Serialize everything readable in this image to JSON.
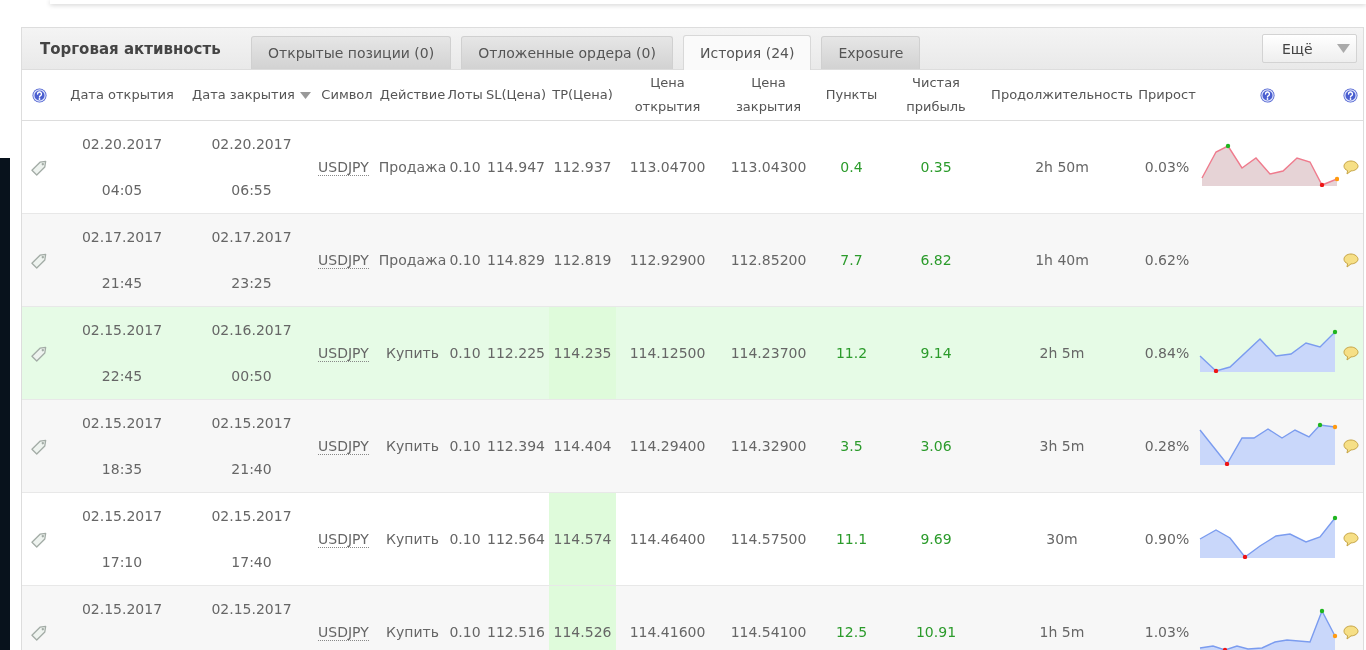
{
  "panel": {
    "title": "Торговая активность",
    "tabs": [
      {
        "label": "Открытые позиции (0)",
        "selected": false
      },
      {
        "label": "Отложенные ордера (0)",
        "selected": false
      },
      {
        "label": "История (24)",
        "selected": true
      },
      {
        "label": "Exposure",
        "selected": false
      }
    ],
    "more_button": "Ещё"
  },
  "table": {
    "columns": [
      {
        "kind": "help",
        "sorted": false
      },
      {
        "kind": "text",
        "label": "Дата открытия",
        "sorted": false
      },
      {
        "kind": "text",
        "label": "Дата закрытия",
        "sorted": true
      },
      {
        "kind": "text",
        "label": "Символ",
        "sorted": false
      },
      {
        "kind": "text",
        "label": "Действие",
        "sorted": false
      },
      {
        "kind": "text",
        "label": "Лоты",
        "sorted": false
      },
      {
        "kind": "text",
        "label": "SL(Цена)",
        "sorted": false
      },
      {
        "kind": "text",
        "label": "TP(Цена)",
        "sorted": false
      },
      {
        "kind": "text",
        "label": "Цена открытия",
        "sorted": false
      },
      {
        "kind": "text",
        "label": "Цена закрытия",
        "sorted": false
      },
      {
        "kind": "text",
        "label": "Пункты",
        "sorted": false
      },
      {
        "kind": "text",
        "label": "Чистая прибыль",
        "sorted": false
      },
      {
        "kind": "text",
        "label": "Продолжительность",
        "sorted": false
      },
      {
        "kind": "text",
        "label": "Прирост",
        "sorted": false
      },
      {
        "kind": "help",
        "sorted": false
      },
      {
        "kind": "help",
        "sorted": false
      }
    ],
    "rows": [
      {
        "open_date": "02.20.2017",
        "open_time": "04:05",
        "close_date": "02.20.2017",
        "close_time": "06:55",
        "symbol": "USDJPY",
        "action": "Продажа",
        "lots": "0.10",
        "sl": "114.947",
        "tp": "112.937",
        "open_price": "113.04700",
        "close_price": "113.04300",
        "pips": "0.4",
        "profit": "0.35",
        "duration": "2h 50m",
        "gain": "0.03%",
        "highlighted": false,
        "tp_highlighted": false,
        "sparkline": {
          "color": "#e6d3d6"
        }
      },
      {
        "open_date": "02.17.2017",
        "open_time": "21:45",
        "close_date": "02.17.2017",
        "close_time": "23:25",
        "symbol": "USDJPY",
        "action": "Продажа",
        "lots": "0.10",
        "sl": "114.829",
        "tp": "112.819",
        "open_price": "112.92900",
        "close_price": "112.85200",
        "pips": "7.7",
        "profit": "6.82",
        "duration": "1h 40m",
        "gain": "0.62%",
        "highlighted": false,
        "tp_highlighted": false
      },
      {
        "open_date": "02.15.2017",
        "open_time": "22:45",
        "close_date": "02.16.2017",
        "close_time": "00:50",
        "symbol": "USDJPY",
        "action": "Купить",
        "lots": "0.10",
        "sl": "112.225",
        "tp": "114.235",
        "open_price": "114.12500",
        "close_price": "114.23700",
        "pips": "11.2",
        "profit": "9.14",
        "duration": "2h 5m",
        "gain": "0.84%",
        "highlighted": true,
        "tp_highlighted": true,
        "sparkline": {
          "color": "#c9d7fa"
        }
      },
      {
        "open_date": "02.15.2017",
        "open_time": "18:35",
        "close_date": "02.15.2017",
        "close_time": "21:40",
        "symbol": "USDJPY",
        "action": "Купить",
        "lots": "0.10",
        "sl": "112.394",
        "tp": "114.404",
        "open_price": "114.29400",
        "close_price": "114.32900",
        "pips": "3.5",
        "profit": "3.06",
        "duration": "3h 5m",
        "gain": "0.28%",
        "highlighted": false,
        "tp_highlighted": false,
        "sparkline": {
          "color": "#c9d7fa"
        }
      },
      {
        "open_date": "02.15.2017",
        "open_time": "17:10",
        "close_date": "02.15.2017",
        "close_time": "17:40",
        "symbol": "USDJPY",
        "action": "Купить",
        "lots": "0.10",
        "sl": "112.564",
        "tp": "114.574",
        "open_price": "114.46400",
        "close_price": "114.57500",
        "pips": "11.1",
        "profit": "9.69",
        "duration": "30m",
        "gain": "0.90%",
        "highlighted": false,
        "tp_highlighted": true,
        "sparkline": {
          "color": "#c9d7fa"
        }
      },
      {
        "open_date": "02.15.2017",
        "close_date": "02.15.2017",
        "symbol": "USDJPY",
        "action": "Купить",
        "lots": "0.10",
        "sl": "112.516",
        "tp": "114.526",
        "open_price": "114.41600",
        "close_price": "114.54100",
        "pips": "12.5",
        "profit": "10.91",
        "duration": "1h 5m",
        "gain": "1.03%",
        "highlighted": false,
        "tp_highlighted": true,
        "sparkline": {
          "color": "#c9d7fa"
        }
      }
    ]
  }
}
